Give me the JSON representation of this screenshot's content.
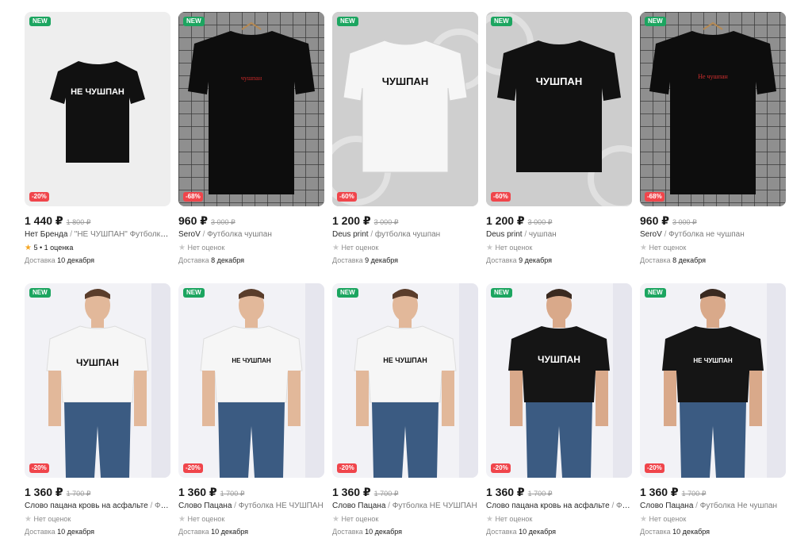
{
  "products": [
    {
      "badge": "NEW",
      "discount": "-20%",
      "price": "1 440 ₽",
      "old_price": "1 800 ₽",
      "brand": "Нет Бренда",
      "desc": "\"НЕ ЧУШПАН\" Футболка Сл...",
      "rating_text": "5 • 1 оценка",
      "has_rating": true,
      "delivery_label": "Доставка",
      "delivery_date": "10 декабря",
      "shirt_text": "НЕ ЧУШПАН",
      "shirt_color": "#111111"
    },
    {
      "badge": "NEW",
      "discount": "-68%",
      "price": "960 ₽",
      "old_price": "3 000 ₽",
      "brand": "SeroV",
      "desc": "Футболка чушпан",
      "rating_text": "Нет оценок",
      "has_rating": false,
      "delivery_label": "Доставка",
      "delivery_date": "8 декабря",
      "shirt_text": "чушпан",
      "shirt_color": "#111111"
    },
    {
      "badge": "NEW",
      "discount": "-60%",
      "price": "1 200 ₽",
      "old_price": "3 000 ₽",
      "brand": "Deus print",
      "desc": "футболка чушпан",
      "rating_text": "Нет оценок",
      "has_rating": false,
      "delivery_label": "Доставка",
      "delivery_date": "9 декабря",
      "shirt_text": "ЧУШПАН",
      "shirt_color": "#f4f4f4"
    },
    {
      "badge": "NEW",
      "discount": "-60%",
      "price": "1 200 ₽",
      "old_price": "3 000 ₽",
      "brand": "Deus print",
      "desc": "чушпан",
      "rating_text": "Нет оценок",
      "has_rating": false,
      "delivery_label": "Доставка",
      "delivery_date": "9 декабря",
      "shirt_text": "ЧУШПАН",
      "shirt_color": "#111111"
    },
    {
      "badge": "NEW",
      "discount": "-68%",
      "price": "960 ₽",
      "old_price": "3 000 ₽",
      "brand": "SeroV",
      "desc": "Футболка не чушпан",
      "rating_text": "Нет оценок",
      "has_rating": false,
      "delivery_label": "Доставка",
      "delivery_date": "8 декабря",
      "shirt_text": "Не чушпан",
      "shirt_color": "#111111"
    },
    {
      "badge": "NEW",
      "discount": "-20%",
      "price": "1 360 ₽",
      "old_price": "1 700 ₽",
      "brand": "Слово пацана кровь на асфальте",
      "desc": "Футболка",
      "rating_text": "Нет оценок",
      "has_rating": false,
      "delivery_label": "Доставка",
      "delivery_date": "10 декабря",
      "shirt_text": "ЧУШПАН",
      "shirt_color": "#f6f6f6"
    },
    {
      "badge": "NEW",
      "discount": "-20%",
      "price": "1 360 ₽",
      "old_price": "1 700 ₽",
      "brand": "Слово Пацана",
      "desc": "Футболка НЕ ЧУШПАН",
      "rating_text": "Нет оценок",
      "has_rating": false,
      "delivery_label": "Доставка",
      "delivery_date": "10 декабря",
      "shirt_text": "НЕ ЧУШПАН",
      "shirt_color": "#f6f6f6"
    },
    {
      "badge": "NEW",
      "discount": "-20%",
      "price": "1 360 ₽",
      "old_price": "1 700 ₽",
      "brand": "Слово Пацана",
      "desc": "Футболка НЕ ЧУШПАН",
      "rating_text": "Нет оценок",
      "has_rating": false,
      "delivery_label": "Доставка",
      "delivery_date": "10 декабря",
      "shirt_text": "НЕ ЧУШПАН",
      "shirt_color": "#f6f6f6"
    },
    {
      "badge": "NEW",
      "discount": "-20%",
      "price": "1 360 ₽",
      "old_price": "1 700 ₽",
      "brand": "Слово пацана кровь на асфальте",
      "desc": "Футбо...",
      "rating_text": "Нет оценок",
      "has_rating": false,
      "delivery_label": "Доставка",
      "delivery_date": "10 декабря",
      "shirt_text": "ЧУШПАН",
      "shirt_color": "#151515"
    },
    {
      "badge": "NEW",
      "discount": "-20%",
      "price": "1 360 ₽",
      "old_price": "1 700 ₽",
      "brand": "Слово Пацана",
      "desc": "Футболка Не чушпан",
      "rating_text": "Нет оценок",
      "has_rating": false,
      "delivery_label": "Доставка",
      "delivery_date": "10 декабря",
      "shirt_text": "НЕ ЧУШПАН",
      "shirt_color": "#151515"
    }
  ],
  "colors": {
    "new_badge": "#1ca560",
    "discount_badge": "#f0454b",
    "star_on": "#f5a623"
  }
}
